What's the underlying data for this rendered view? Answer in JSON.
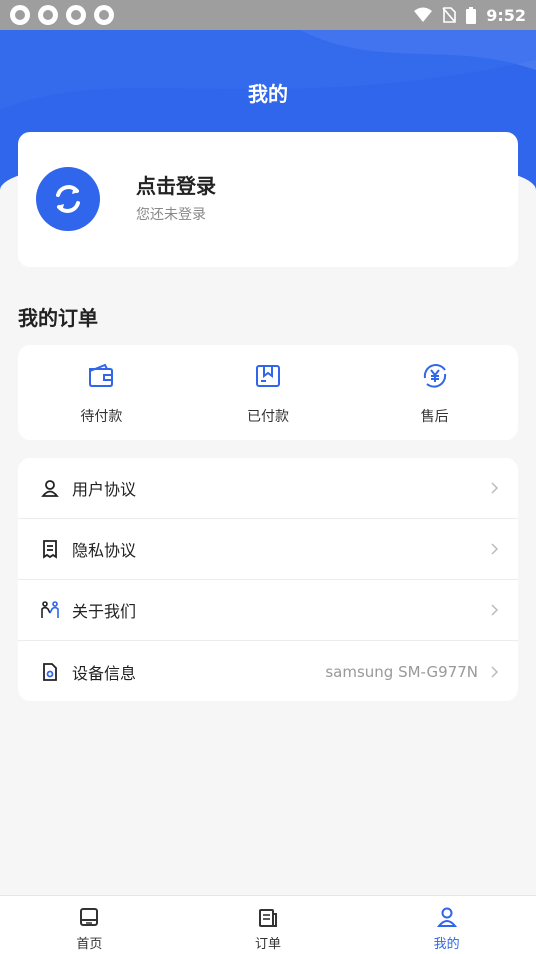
{
  "status_bar": {
    "time": "9:52",
    "app_icons": [
      "app-notification-icon",
      "app-notification-icon",
      "app-notification-icon",
      "app-notification-icon"
    ]
  },
  "header": {
    "title": "我的"
  },
  "profile": {
    "title": "点击登录",
    "subtitle": "您还未登录",
    "avatar_icon": "refresh-avatar-icon"
  },
  "orders": {
    "section_title": "我的订单",
    "items": [
      {
        "label": "待付款",
        "icon": "wallet-icon"
      },
      {
        "label": "已付款",
        "icon": "box-icon"
      },
      {
        "label": "售后",
        "icon": "yuan-refund-icon"
      }
    ]
  },
  "menu": {
    "items": [
      {
        "label": "用户协议",
        "icon": "user-agreement-icon",
        "value": ""
      },
      {
        "label": "隐私协议",
        "icon": "privacy-document-icon",
        "value": ""
      },
      {
        "label": "关于我们",
        "icon": "people-icon",
        "value": ""
      },
      {
        "label": "设备信息",
        "icon": "device-file-icon",
        "value": "samsung SM-G977N"
      }
    ]
  },
  "tabbar": {
    "items": [
      {
        "label": "首页",
        "icon": "home-icon",
        "active": false
      },
      {
        "label": "订单",
        "icon": "orders-icon",
        "active": false
      },
      {
        "label": "我的",
        "icon": "profile-icon",
        "active": true
      }
    ]
  },
  "colors": {
    "accent": "#2f66ec",
    "background": "#f6f6f6",
    "muted": "#999999"
  }
}
